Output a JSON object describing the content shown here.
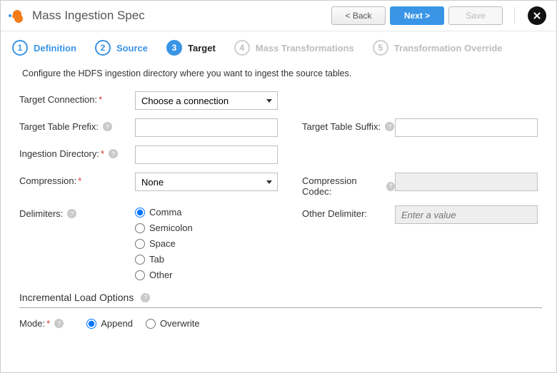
{
  "header": {
    "title": "Mass Ingestion Spec",
    "back": "< Back",
    "next": "Next >",
    "save": "Save"
  },
  "steps": [
    {
      "num": "1",
      "label": "Definition"
    },
    {
      "num": "2",
      "label": "Source"
    },
    {
      "num": "3",
      "label": "Target"
    },
    {
      "num": "4",
      "label": "Mass Transformations"
    },
    {
      "num": "5",
      "label": "Transformation Override"
    }
  ],
  "intro": "Configure the HDFS ingestion directory where you want to ingest the source tables.",
  "labels": {
    "targetConnection": "Target Connection:",
    "targetTablePrefix": "Target Table Prefix:",
    "targetTableSuffix": "Target Table Suffix:",
    "ingestionDirectory": "Ingestion Directory:",
    "compression": "Compression:",
    "compressionCodec": "Compression Codec:",
    "delimiters": "Delimiters:",
    "otherDelimiter": "Other Delimiter:",
    "mode": "Mode:"
  },
  "values": {
    "targetConnection": "Choose a connection",
    "compression": "None",
    "targetTablePrefix": "",
    "targetTableSuffix": "",
    "ingestionDirectory": "",
    "compressionCodec": "",
    "otherDelimiterPlaceholder": "Enter a value"
  },
  "delimiters": {
    "comma": "Comma",
    "semicolon": "Semicolon",
    "space": "Space",
    "tab": "Tab",
    "other": "Other"
  },
  "sections": {
    "incremental": "Incremental Load Options"
  },
  "mode": {
    "append": "Append",
    "overwrite": "Overwrite"
  }
}
